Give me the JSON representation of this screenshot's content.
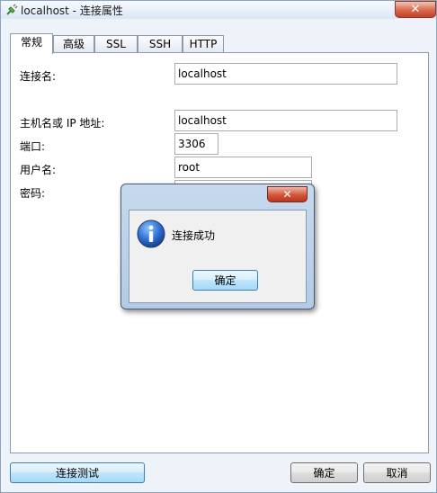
{
  "window": {
    "title": "localhost - 连接属性"
  },
  "tabs": [
    "常规",
    "高级",
    "SSL",
    "SSH",
    "HTTP"
  ],
  "form": {
    "connection_name_label": "连接名:",
    "connection_name_value": "localhost",
    "host_label": "主机名或 IP 地址:",
    "host_value": "localhost",
    "port_label": "端口:",
    "port_value": "3306",
    "username_label": "用户名:",
    "username_value": "root",
    "password_label": "密码:"
  },
  "buttons": {
    "test": "连接测试",
    "ok": "确定",
    "cancel": "取消"
  },
  "dialog": {
    "message": "连接成功",
    "ok_label": "确定"
  },
  "colors": {
    "accent": "#3c7fb1",
    "close": "#c0412a"
  },
  "icons": {
    "app": "plug-icon",
    "info": "info-icon",
    "close": "close-icon"
  }
}
